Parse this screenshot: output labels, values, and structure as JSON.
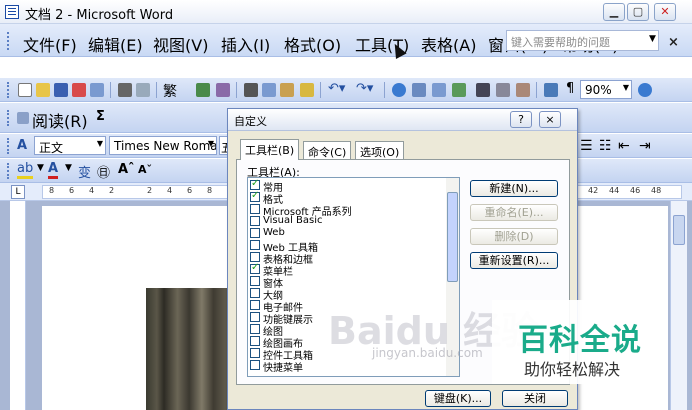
{
  "window": {
    "title": "文档 2 - Microsoft Word"
  },
  "menubar": {
    "items": [
      "文件(F)",
      "编辑(E)",
      "视图(V)",
      "插入(I)",
      "格式(O)",
      "工具(T)",
      "表格(A)",
      "窗口(W)",
      "帮助(H)"
    ],
    "help_placeholder": "键入需要帮助的问题"
  },
  "standard_toolbar": {
    "zoom": "90%"
  },
  "reading_toolbar": {
    "label": "阅读(R)"
  },
  "format_toolbar": {
    "style": "正文",
    "font": "Times New Roman",
    "font_partial": "五"
  },
  "ruler": {
    "numbers": [
      "8",
      "6",
      "4",
      "2",
      "2",
      "4",
      "6",
      "8",
      "42",
      "44",
      "46",
      "48"
    ]
  },
  "dialog": {
    "title": "自定义",
    "help_btn": "?",
    "close_btn": "×",
    "tabs": [
      "工具栏(B)",
      "命令(C)",
      "选项(O)"
    ],
    "list_label": "工具栏(A):",
    "toolbars": [
      {
        "name": "常用",
        "checked": true
      },
      {
        "name": "格式",
        "checked": true
      },
      {
        "name": "Microsoft 产品系列",
        "checked": false
      },
      {
        "name": "Visual Basic",
        "checked": false
      },
      {
        "name": "Web",
        "checked": false
      },
      {
        "name": "Web 工具箱",
        "checked": false
      },
      {
        "name": "表格和边框",
        "checked": false
      },
      {
        "name": "菜单栏",
        "checked": true
      },
      {
        "name": "窗体",
        "checked": false
      },
      {
        "name": "大纲",
        "checked": false
      },
      {
        "name": "电子邮件",
        "checked": false
      },
      {
        "name": "功能键展示",
        "checked": false
      },
      {
        "name": "绘图",
        "checked": false
      },
      {
        "name": "绘图画布",
        "checked": false
      },
      {
        "name": "控件工具箱",
        "checked": false
      },
      {
        "name": "快捷菜单",
        "checked": false
      }
    ],
    "buttons": {
      "new": "新建(N)...",
      "rename": "重命名(E)...",
      "delete": "删除(D)",
      "reset": "重新设置(R)...",
      "keyboard": "键盘(K)...",
      "close": "关闭"
    }
  },
  "watermark": {
    "brand": "Baidu 经验",
    "url": "jingyan.baidu.com"
  },
  "badge": {
    "title": "百科全说",
    "subtitle": "助你轻松解决"
  }
}
